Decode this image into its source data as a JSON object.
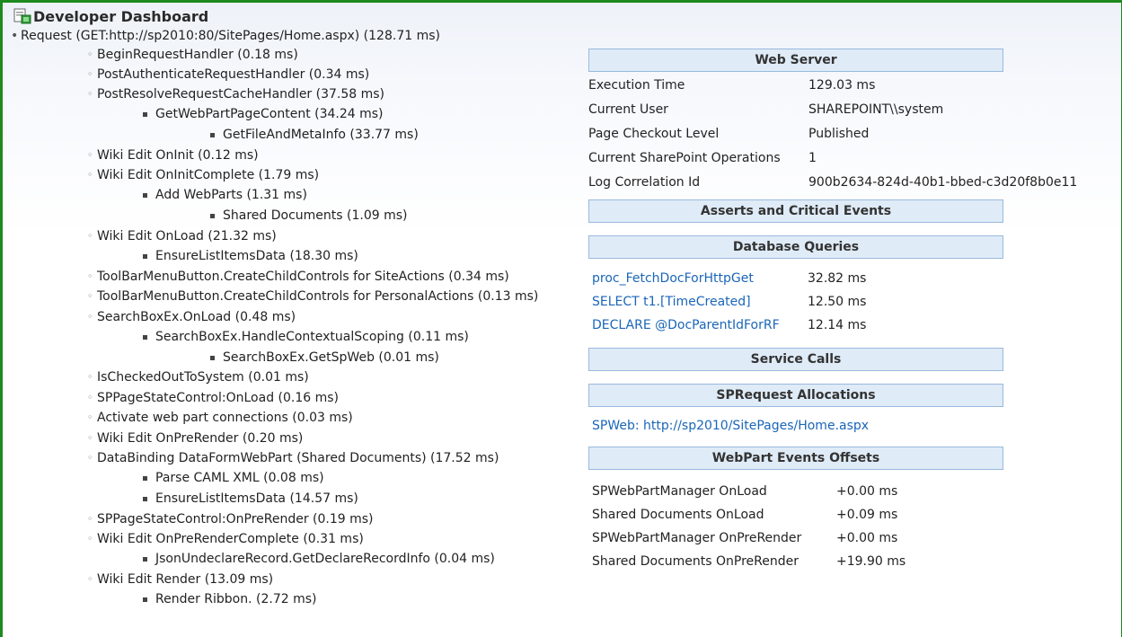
{
  "title": "Developer Dashboard",
  "tree": [
    {
      "level": 1,
      "text": "Request (GET:http://sp2010:80/SitePages/Home.aspx) (128.71 ms)"
    },
    {
      "level": 2,
      "text": "BeginRequestHandler (0.18 ms)"
    },
    {
      "level": 2,
      "text": "PostAuthenticateRequestHandler (0.34 ms)"
    },
    {
      "level": 2,
      "text": "PostResolveRequestCacheHandler (37.58 ms)"
    },
    {
      "level": 3,
      "text": "GetWebPartPageContent (34.24 ms)"
    },
    {
      "level": 4,
      "text": "GetFileAndMetaInfo (33.77 ms)"
    },
    {
      "level": 2,
      "text": "Wiki Edit OnInit (0.12 ms)"
    },
    {
      "level": 2,
      "text": "Wiki Edit OnInitComplete (1.79 ms)"
    },
    {
      "level": 3,
      "text": "Add WebParts (1.31 ms)"
    },
    {
      "level": 4,
      "text": "Shared Documents (1.09 ms)"
    },
    {
      "level": 2,
      "text": "Wiki Edit OnLoad (21.32 ms)"
    },
    {
      "level": 3,
      "text": "EnsureListItemsData (18.30 ms)"
    },
    {
      "level": 2,
      "text": "ToolBarMenuButton.CreateChildControls for SiteActions (0.34 ms)"
    },
    {
      "level": 2,
      "text": "ToolBarMenuButton.CreateChildControls for PersonalActions (0.13 ms)"
    },
    {
      "level": 2,
      "text": "SearchBoxEx.OnLoad (0.48 ms)"
    },
    {
      "level": 3,
      "text": "SearchBoxEx.HandleContextualScoping (0.11 ms)"
    },
    {
      "level": 4,
      "text": "SearchBoxEx.GetSpWeb (0.01 ms)"
    },
    {
      "level": 2,
      "text": "IsCheckedOutToSystem (0.01 ms)"
    },
    {
      "level": 2,
      "text": "SPPageStateControl:OnLoad (0.16 ms)"
    },
    {
      "level": 2,
      "text": "Activate web part connections (0.03 ms)"
    },
    {
      "level": 2,
      "text": "Wiki Edit OnPreRender (0.20 ms)"
    },
    {
      "level": 2,
      "text": "DataBinding DataFormWebPart (Shared Documents) (17.52 ms)"
    },
    {
      "level": 3,
      "text": "Parse CAML XML (0.08 ms)"
    },
    {
      "level": 3,
      "text": "EnsureListItemsData (14.57 ms)"
    },
    {
      "level": 2,
      "text": "SPPageStateControl:OnPreRender (0.19 ms)"
    },
    {
      "level": 2,
      "text": "Wiki Edit OnPreRenderComplete (0.31 ms)"
    },
    {
      "level": 3,
      "text": "JsonUndeclareRecord.GetDeclareRecordInfo (0.04 ms)"
    },
    {
      "level": 2,
      "text": "Wiki Edit Render (13.09 ms)"
    },
    {
      "level": 3,
      "text": "Render Ribbon. (2.72 ms)"
    }
  ],
  "web_server": {
    "header": "Web Server",
    "rows": [
      {
        "key": "Execution Time",
        "value": "129.03 ms"
      },
      {
        "key": "Current User",
        "value": "SHAREPOINT\\\\system"
      },
      {
        "key": "Page Checkout Level",
        "value": "Published"
      },
      {
        "key": "Current SharePoint Operations",
        "value": "1"
      },
      {
        "key": "Log Correlation Id",
        "value": "900b2634-824d-40b1-bbed-c3d20f8b0e11"
      }
    ]
  },
  "asserts": {
    "header": "Asserts and Critical Events"
  },
  "database": {
    "header": "Database Queries",
    "rows": [
      {
        "query": "proc_FetchDocForHttpGet",
        "time": "32.82 ms"
      },
      {
        "query": "SELECT t1.[TimeCreated]",
        "time": "12.50 ms"
      },
      {
        "query": "DECLARE @DocParentIdForRF",
        "time": "12.14 ms"
      }
    ]
  },
  "service_calls": {
    "header": "Service Calls"
  },
  "sprequest": {
    "header": "SPRequest Allocations",
    "link": "SPWeb: http://sp2010/SitePages/Home.aspx"
  },
  "webpart_events": {
    "header": "WebPart Events Offsets",
    "rows": [
      {
        "event": "SPWebPartManager OnLoad",
        "offset": "+0.00 ms"
      },
      {
        "event": "Shared Documents OnLoad",
        "offset": "+0.09 ms"
      },
      {
        "event": "SPWebPartManager OnPreRender",
        "offset": "+0.00 ms"
      },
      {
        "event": "Shared Documents OnPreRender",
        "offset": "+19.90 ms"
      }
    ]
  },
  "colors": {
    "frame": "#1e8a1e",
    "header_bg": "#dfebf7",
    "header_border": "#9ab9dd",
    "link": "#1a66b8"
  }
}
